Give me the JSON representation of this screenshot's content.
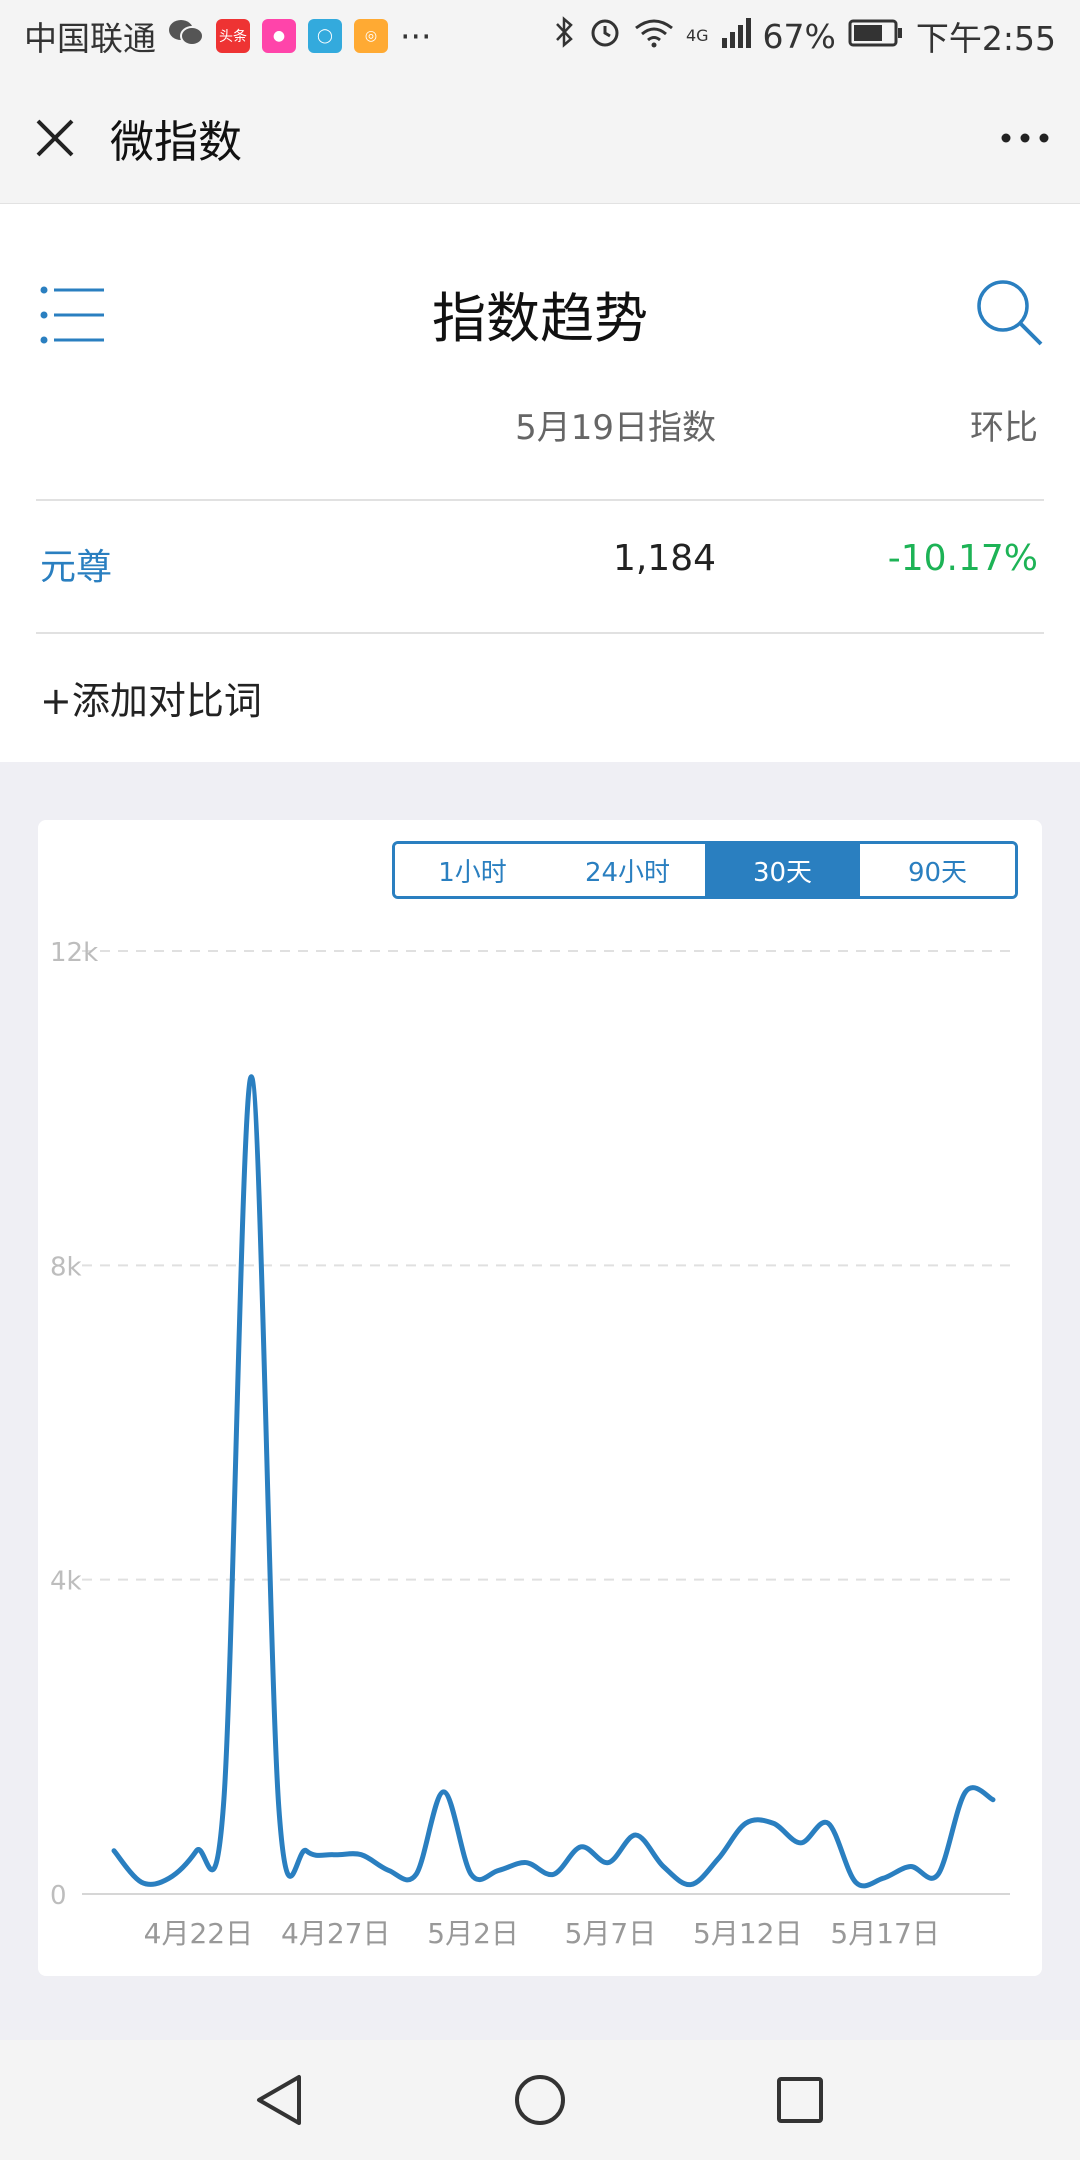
{
  "status_bar": {
    "carrier": "中国联通",
    "app_icon_news_label": "头条",
    "more": "···",
    "network": "4G",
    "battery": "67%",
    "time": "下午2:55"
  },
  "window": {
    "title": "微指数"
  },
  "page": {
    "title": "指数趋势",
    "columns": {
      "date_index": "5月19日指数",
      "ratio": "环比"
    },
    "rows": [
      {
        "word": "元尊",
        "value": "1,184",
        "ratio": "-10.17%"
      }
    ],
    "add_compare": "+添加对比词"
  },
  "tabs": [
    {
      "label": "1小时",
      "active": false
    },
    {
      "label": "24小时",
      "active": false
    },
    {
      "label": "30天",
      "active": true
    },
    {
      "label": "90天",
      "active": false
    }
  ],
  "colors": {
    "accent": "#2a7fc0",
    "positive_down": "#1db356"
  },
  "chart_data": {
    "type": "line",
    "ylim": [
      0,
      12000
    ],
    "yticks": [
      {
        "v": 0,
        "label": "0"
      },
      {
        "v": 4000,
        "label": "4k"
      },
      {
        "v": 8000,
        "label": "8k"
      },
      {
        "v": 12000,
        "label": "12k"
      }
    ],
    "x_ticks": [
      {
        "i": 3,
        "label": "4月22日"
      },
      {
        "i": 8,
        "label": "4月27日"
      },
      {
        "i": 13,
        "label": "5月2日"
      },
      {
        "i": 18,
        "label": "5月7日"
      },
      {
        "i": 23,
        "label": "5月12日"
      },
      {
        "i": 28,
        "label": "5月17日"
      }
    ],
    "series": [
      {
        "values": [
          550,
          150,
          200,
          550,
          1200,
          10400,
          1100,
          550,
          500,
          500,
          300,
          250,
          1300,
          250,
          300,
          400,
          250,
          600,
          400,
          750,
          350,
          120,
          450,
          900,
          900,
          650,
          900,
          150,
          200,
          350,
          250,
          1300,
          1200
        ]
      }
    ]
  }
}
